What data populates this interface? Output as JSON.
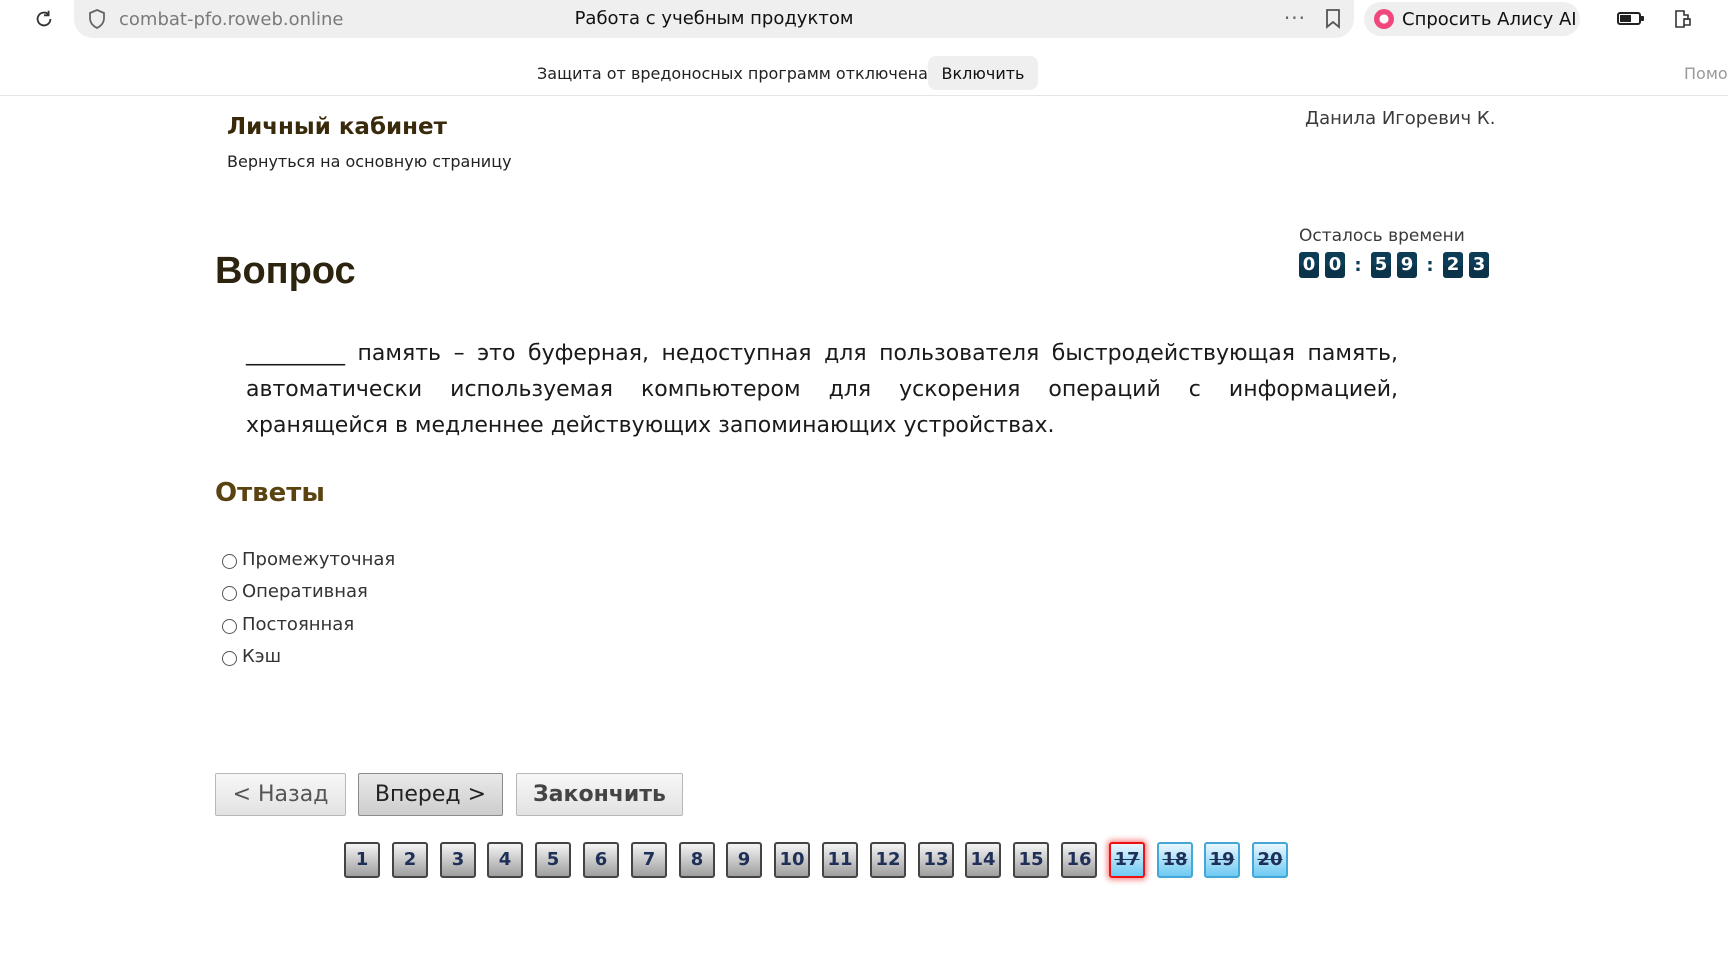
{
  "browser": {
    "url": "combat-pfo.roweb.online",
    "tab_title": "Работа с учебным продуктом",
    "more": "···",
    "alice_label": "Спросить Алису AI"
  },
  "notification": {
    "text": "Защита от вредоносных программ отключена",
    "enable_button": "Включить",
    "help_cut": "Помо"
  },
  "header": {
    "cabinet_title": "Личный кабинет",
    "back_link": "Вернуться на основную страницу",
    "user_name": "Данила Игоревич К."
  },
  "timer": {
    "label": "Осталось времени",
    "d1": "0",
    "d2": "0",
    "sep1": ":",
    "d3": "5",
    "d4": "9",
    "sep2": ":",
    "d5": "2",
    "d6": "3"
  },
  "question": {
    "heading": "Вопрос",
    "text": "_________ память – это буферная, недоступная для пользователя быстродействующая память, автоматически используемая компьютером для ускорения операций с информацией, хранящейся в медленнее действующих запоминающих устройствах."
  },
  "answers": {
    "heading": "Ответы",
    "options": [
      "Промежуточная",
      "Оперативная",
      "Постоянная",
      "Кэш"
    ]
  },
  "nav": {
    "back": "< Назад",
    "next": "Вперед >",
    "finish": "Закончить"
  },
  "pager": {
    "pages": [
      "1",
      "2",
      "3",
      "4",
      "5",
      "6",
      "7",
      "8",
      "9",
      "10",
      "11",
      "12",
      "13",
      "14",
      "15",
      "16",
      "17",
      "18",
      "19",
      "20"
    ],
    "current": "17",
    "answered": [
      "17",
      "18",
      "19",
      "20"
    ]
  },
  "colors": {
    "timer_digit_bg": "#0d3d56",
    "title_brown": "#3a2a0c",
    "answers_heading": "#5a4310",
    "page_done": "#6ecaf3",
    "page_current_border": "#ee1111"
  }
}
